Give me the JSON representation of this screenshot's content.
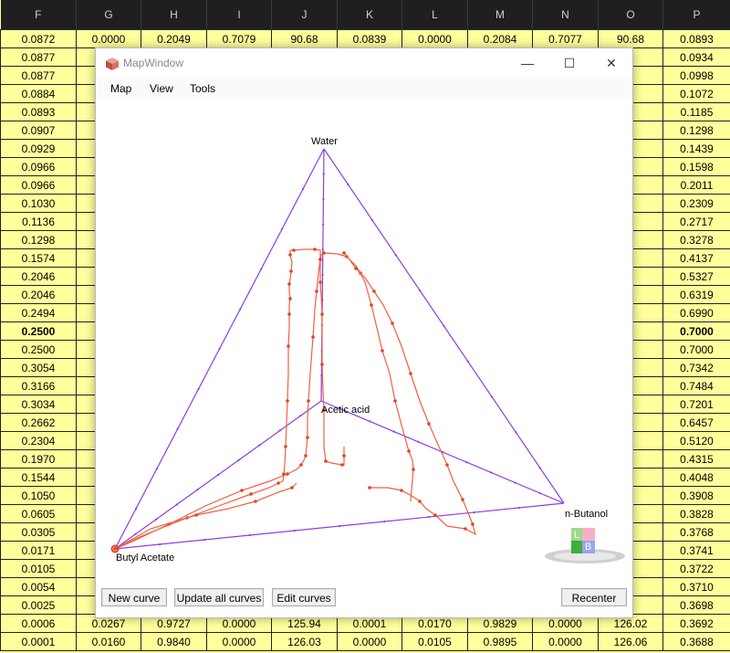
{
  "spreadsheet": {
    "columns": [
      "F",
      "G",
      "H",
      "I",
      "J",
      "K",
      "L",
      "M",
      "N",
      "O",
      "P"
    ],
    "rows": [
      {
        "F": "0.0872",
        "G": "0.0000",
        "H": "0.2049",
        "I": "0.7079",
        "J": "90.68",
        "K": "0.0839",
        "L": "0.0000",
        "M": "0.2084",
        "N": "0.7077",
        "O": "90.68",
        "P": "0.0893"
      },
      {
        "F": "0.0877",
        "G": "0",
        "O": ".68",
        "P": "0.0934"
      },
      {
        "F": "0.0877",
        "G": "0",
        "O": ".68",
        "P": "0.0998"
      },
      {
        "F": "0.0884",
        "G": "0",
        "O": ".69",
        "P": "0.1072"
      },
      {
        "F": "0.0893",
        "G": "0",
        "O": ".71",
        "P": "0.1185"
      },
      {
        "F": "0.0907",
        "G": "0",
        "O": ".73",
        "P": "0.1298"
      },
      {
        "F": "0.0929",
        "G": "0",
        "O": ".77",
        "P": "0.1439"
      },
      {
        "F": "0.0966",
        "G": "0",
        "O": ".84",
        "P": "0.1598"
      },
      {
        "F": "0.0966",
        "G": "0",
        "O": ".95",
        "P": "0.2011"
      },
      {
        "F": "0.1030",
        "G": "0",
        "O": ".13",
        "P": "0.2309"
      },
      {
        "F": "0.1136",
        "G": "0",
        "O": ".37",
        "P": "0.2717"
      },
      {
        "F": "0.1298",
        "G": "0",
        "O": ".68",
        "P": "0.3278"
      },
      {
        "F": "0.1574",
        "G": "0",
        "O": ".04",
        "P": "0.4137"
      },
      {
        "F": "0.2046",
        "G": "0",
        "O": ".90",
        "P": "0.5327"
      },
      {
        "F": "0.2046",
        "G": "0",
        "O": ".45",
        "P": "0.6319"
      },
      {
        "F": "0.2494",
        "G": "0",
        "O": "0.37",
        "P": "0.6990"
      },
      {
        "F": "0.2500",
        "G": "0",
        "O": "0.49",
        "P": "0.7000",
        "bold": true
      },
      {
        "F": "0.2500",
        "G": "0",
        "O": "0.49",
        "P": "0.7000"
      },
      {
        "F": "0.3054",
        "G": "0",
        "O": "2.67",
        "P": "0.7342"
      },
      {
        "F": "0.3166",
        "G": "0",
        "O": "0.11",
        "P": "0.7484"
      },
      {
        "F": "0.3034",
        "G": "0",
        "O": "1.60",
        "P": "0.7201"
      },
      {
        "F": "0.2662",
        "G": "0",
        "O": "1.94",
        "P": "0.6457"
      },
      {
        "F": "0.2304",
        "G": "0",
        "O": "3.02",
        "P": "0.5120"
      },
      {
        "F": "0.1970",
        "G": "0",
        "O": "3.83",
        "P": "0.4315"
      },
      {
        "F": "0.1544",
        "G": "0",
        "O": "4.51",
        "P": "0.4048"
      },
      {
        "F": "0.1050",
        "G": "0",
        "O": "4.85",
        "P": "0.3908"
      },
      {
        "F": "0.0605",
        "G": "0",
        "O": "5.13",
        "P": "0.3828"
      },
      {
        "F": "0.0305",
        "G": "0",
        "O": "5.36",
        "P": "0.3768"
      },
      {
        "F": "0.0171",
        "G": "0",
        "O": "5.58",
        "P": "0.3741"
      },
      {
        "F": "0.0105",
        "G": "0",
        "O": "5.70",
        "P": "0.3722"
      },
      {
        "F": "0.0054",
        "G": "0",
        "O": "5.81",
        "P": "0.3710"
      },
      {
        "F": "0.0025",
        "G": "0",
        "O": "5.92",
        "P": "0.3698"
      },
      {
        "F": "0.0006",
        "G": "0.0267",
        "H": "0.9727",
        "I": "0.0000",
        "J": "125.94",
        "K": "0.0001",
        "L": "0.0170",
        "M": "0.9829",
        "N": "0.0000",
        "O": "126.02",
        "P": "0.3692"
      },
      {
        "F": "0.0001",
        "G": "0.0160",
        "H": "0.9840",
        "I": "0.0000",
        "J": "126.03",
        "K": "0.0000",
        "L": "0.0105",
        "M": "0.9895",
        "N": "0.0000",
        "O": "126.06",
        "P": "0.3688"
      }
    ]
  },
  "window": {
    "title": "MapWindow",
    "icon": "mapwindow-cube-icon",
    "controls": {
      "minimize": "—",
      "maximize": "☐",
      "close": "✕"
    },
    "menu": [
      "Map",
      "View",
      "Tools"
    ],
    "buttons": {
      "new_curve": "New curve",
      "update_all": "Update all curves",
      "edit_curves": "Edit curves",
      "recenter": "Recenter"
    },
    "badge": {
      "left_letter": "L",
      "right_letter": "B"
    }
  },
  "diagram": {
    "vertex_labels": {
      "top": "Water",
      "center": "Acetic acid",
      "right": "n-Butanol",
      "left": "Butyl Acetate"
    },
    "colors": {
      "edges": "#8a3fe0",
      "curve": "#f06040",
      "points": "#e04525"
    }
  }
}
